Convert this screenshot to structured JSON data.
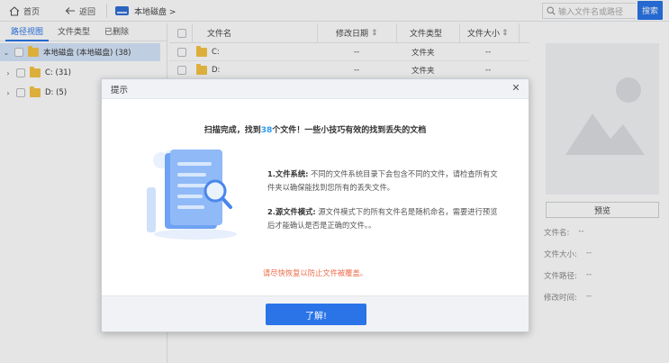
{
  "toolbar": {
    "home_label": "首页",
    "back_label": "返回",
    "path_label": "本地磁盘 >",
    "search_placeholder": "输入文件名或路径",
    "search_button": "搜索"
  },
  "left_panel": {
    "tabs": [
      "路径视图",
      "文件类型",
      "已删除"
    ],
    "active_tab": 0,
    "tree": [
      {
        "label": "本地磁盘 (本地磁盘) (38)",
        "expanded": true,
        "selected": true
      },
      {
        "label": "C: (31)",
        "expanded": false,
        "selected": false
      },
      {
        "label": "D: (5)",
        "expanded": false,
        "selected": false
      }
    ]
  },
  "file_table": {
    "columns": [
      "文件名",
      "修改日期",
      "文件类型",
      "文件大小"
    ],
    "rows": [
      {
        "name": "C:",
        "date": "--",
        "type": "文件夹",
        "size": "--"
      },
      {
        "name": "D:",
        "date": "--",
        "type": "文件夹",
        "size": "--"
      }
    ]
  },
  "preview": {
    "button_label": "预览",
    "fields": [
      {
        "label": "文件名:",
        "value": "--"
      },
      {
        "label": "文件大小:",
        "value": "--"
      },
      {
        "label": "文件路径:",
        "value": "--"
      },
      {
        "label": "修改时间:",
        "value": "--"
      }
    ]
  },
  "dialog": {
    "title": "提示",
    "summary_prefix": "扫描完成，找到",
    "found_count": "38",
    "summary_suffix": "个文件！一些小技巧有效的找到丢失的文档",
    "tip1_head": "1.文件系统:",
    "tip1_body": " 不同的文件系统目录下会包含不同的文件，请检查所有文件夹以确保能找到您所有的丢失文件。",
    "tip2_head": "2.源文件模式:",
    "tip2_body": " 源文件模式下的所有文件名是随机命名，需要进行预览后才能确认是否是正确的文件。。",
    "warning": "请尽快恢复以防止文件被覆盖。",
    "ok_button": "了解!"
  },
  "colors": {
    "accent": "#2a74e8",
    "highlight": "#2a9bf0",
    "warning": "#ef6b4a",
    "folder": "#f5c344"
  }
}
